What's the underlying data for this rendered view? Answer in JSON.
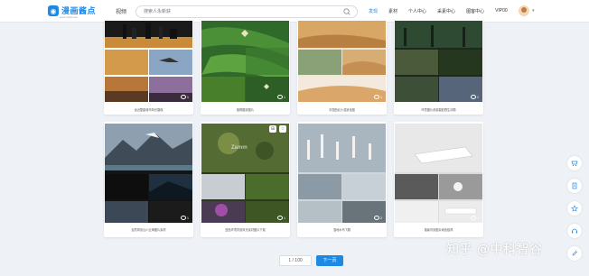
{
  "header": {
    "logo_text": "漫画酱点",
    "logo_sub": "www.mhjd.com",
    "nav_video": "视频",
    "search_placeholder": "搜索人永新获",
    "links": [
      "发现",
      "素材",
      "个人中心",
      "采素中心",
      "图客中心",
      "VIP00"
    ],
    "active_link_index": 0
  },
  "cards": [
    {
      "caption": "远近整距城市风光摄像",
      "count": "1"
    },
    {
      "caption": "植物摄影图片",
      "count": "1"
    },
    {
      "caption": "中国西北沙漠景色图",
      "count": "1"
    },
    {
      "caption": "环境图片资源摄影野生动物",
      "count": "1"
    },
    {
      "caption": "自然风景山川云海图片素材",
      "count": "1"
    },
    {
      "caption": "蓝色环境背景风光素材图片下载",
      "count": "1",
      "watermark": "Zamm"
    },
    {
      "caption": "湿地水鸟飞翔",
      "count": "2"
    },
    {
      "caption": "抽象背景图片纯色极简",
      "count": "1"
    }
  ],
  "pager": {
    "indicator": "1 / 100",
    "next_label": "下一页"
  },
  "sidebar_icons": [
    "cart-icon",
    "document-icon",
    "star-icon",
    "headset-icon",
    "edit-icon"
  ],
  "footer_watermark": "知乎 @中科智谷",
  "colors": {
    "brand": "#1e88e5",
    "page_bg": "#eef1f6"
  }
}
